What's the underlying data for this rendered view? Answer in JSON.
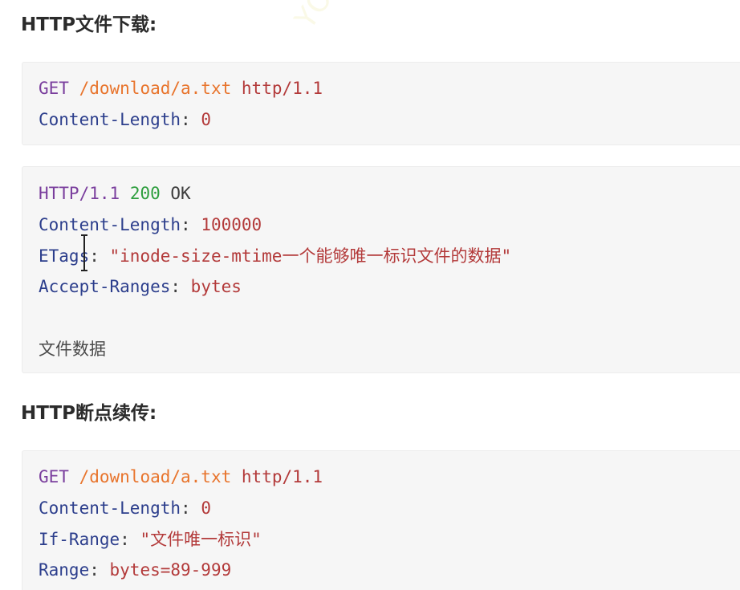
{
  "section1": {
    "heading": "HTTP文件下载:",
    "request": {
      "method": "GET",
      "path": "/download/a.txt",
      "protocol": "http/1.1",
      "header1_name": "Content-Length",
      "header1_value": "0"
    },
    "response": {
      "status_protocol": "HTTP/1.1",
      "status_code": "200",
      "status_text": "OK",
      "header1_name": "Content-Length",
      "header1_value": "100000",
      "header2_name": "ETags",
      "header2_value": "\"inode-size-mtime一个能够唯一标识文件的数据\"",
      "header3_name": "Accept-Ranges",
      "header3_value": "bytes",
      "body_text": "文件数据"
    }
  },
  "section2": {
    "heading": "HTTP断点续传:",
    "request": {
      "method": "GET",
      "path": "/download/a.txt",
      "protocol": "http/1.1",
      "header1_name": "Content-Length",
      "header1_value": "0",
      "header2_name": "If-Range",
      "header2_value": "\"文件唯一标识\"",
      "header3_name": "Range",
      "header3_value": "bytes=89-999"
    }
  },
  "colors": {
    "keyword": "#7a3e9d",
    "path": "#e8742c",
    "protocol": "#b33a3a",
    "number": "#2e9e3e",
    "header_name": "#2c3e8c",
    "code_background": "#f6f6f6"
  },
  "watermark": "YOULYCO"
}
